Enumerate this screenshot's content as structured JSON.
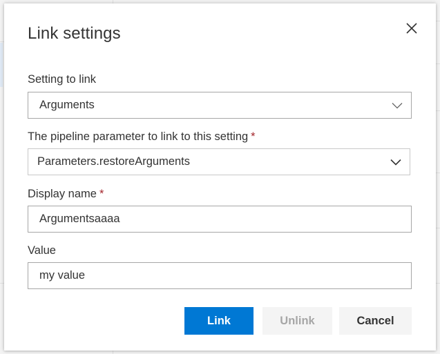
{
  "dialog": {
    "title": "Link settings",
    "close_icon": "close-icon"
  },
  "setting_to_link": {
    "label": "Setting to link",
    "value": "Arguments",
    "icon": "chevron-down-icon"
  },
  "pipeline_parameter": {
    "label": "The pipeline parameter to link to this setting",
    "required_marker": "*",
    "value": "Parameters.restoreArguments",
    "icon": "chevron-down-icon"
  },
  "display_name": {
    "label": "Display name",
    "required_marker": "*",
    "value": "Argumentsaaaa"
  },
  "value_field": {
    "label": "Value",
    "value": "my value"
  },
  "buttons": {
    "link": "Link",
    "unlink": "Unlink",
    "cancel": "Cancel"
  },
  "colors": {
    "primary": "#0078d4",
    "required": "#a4262c",
    "text": "#333333",
    "disabled_text": "#a6a6a6",
    "border": "#a6a6a6"
  }
}
